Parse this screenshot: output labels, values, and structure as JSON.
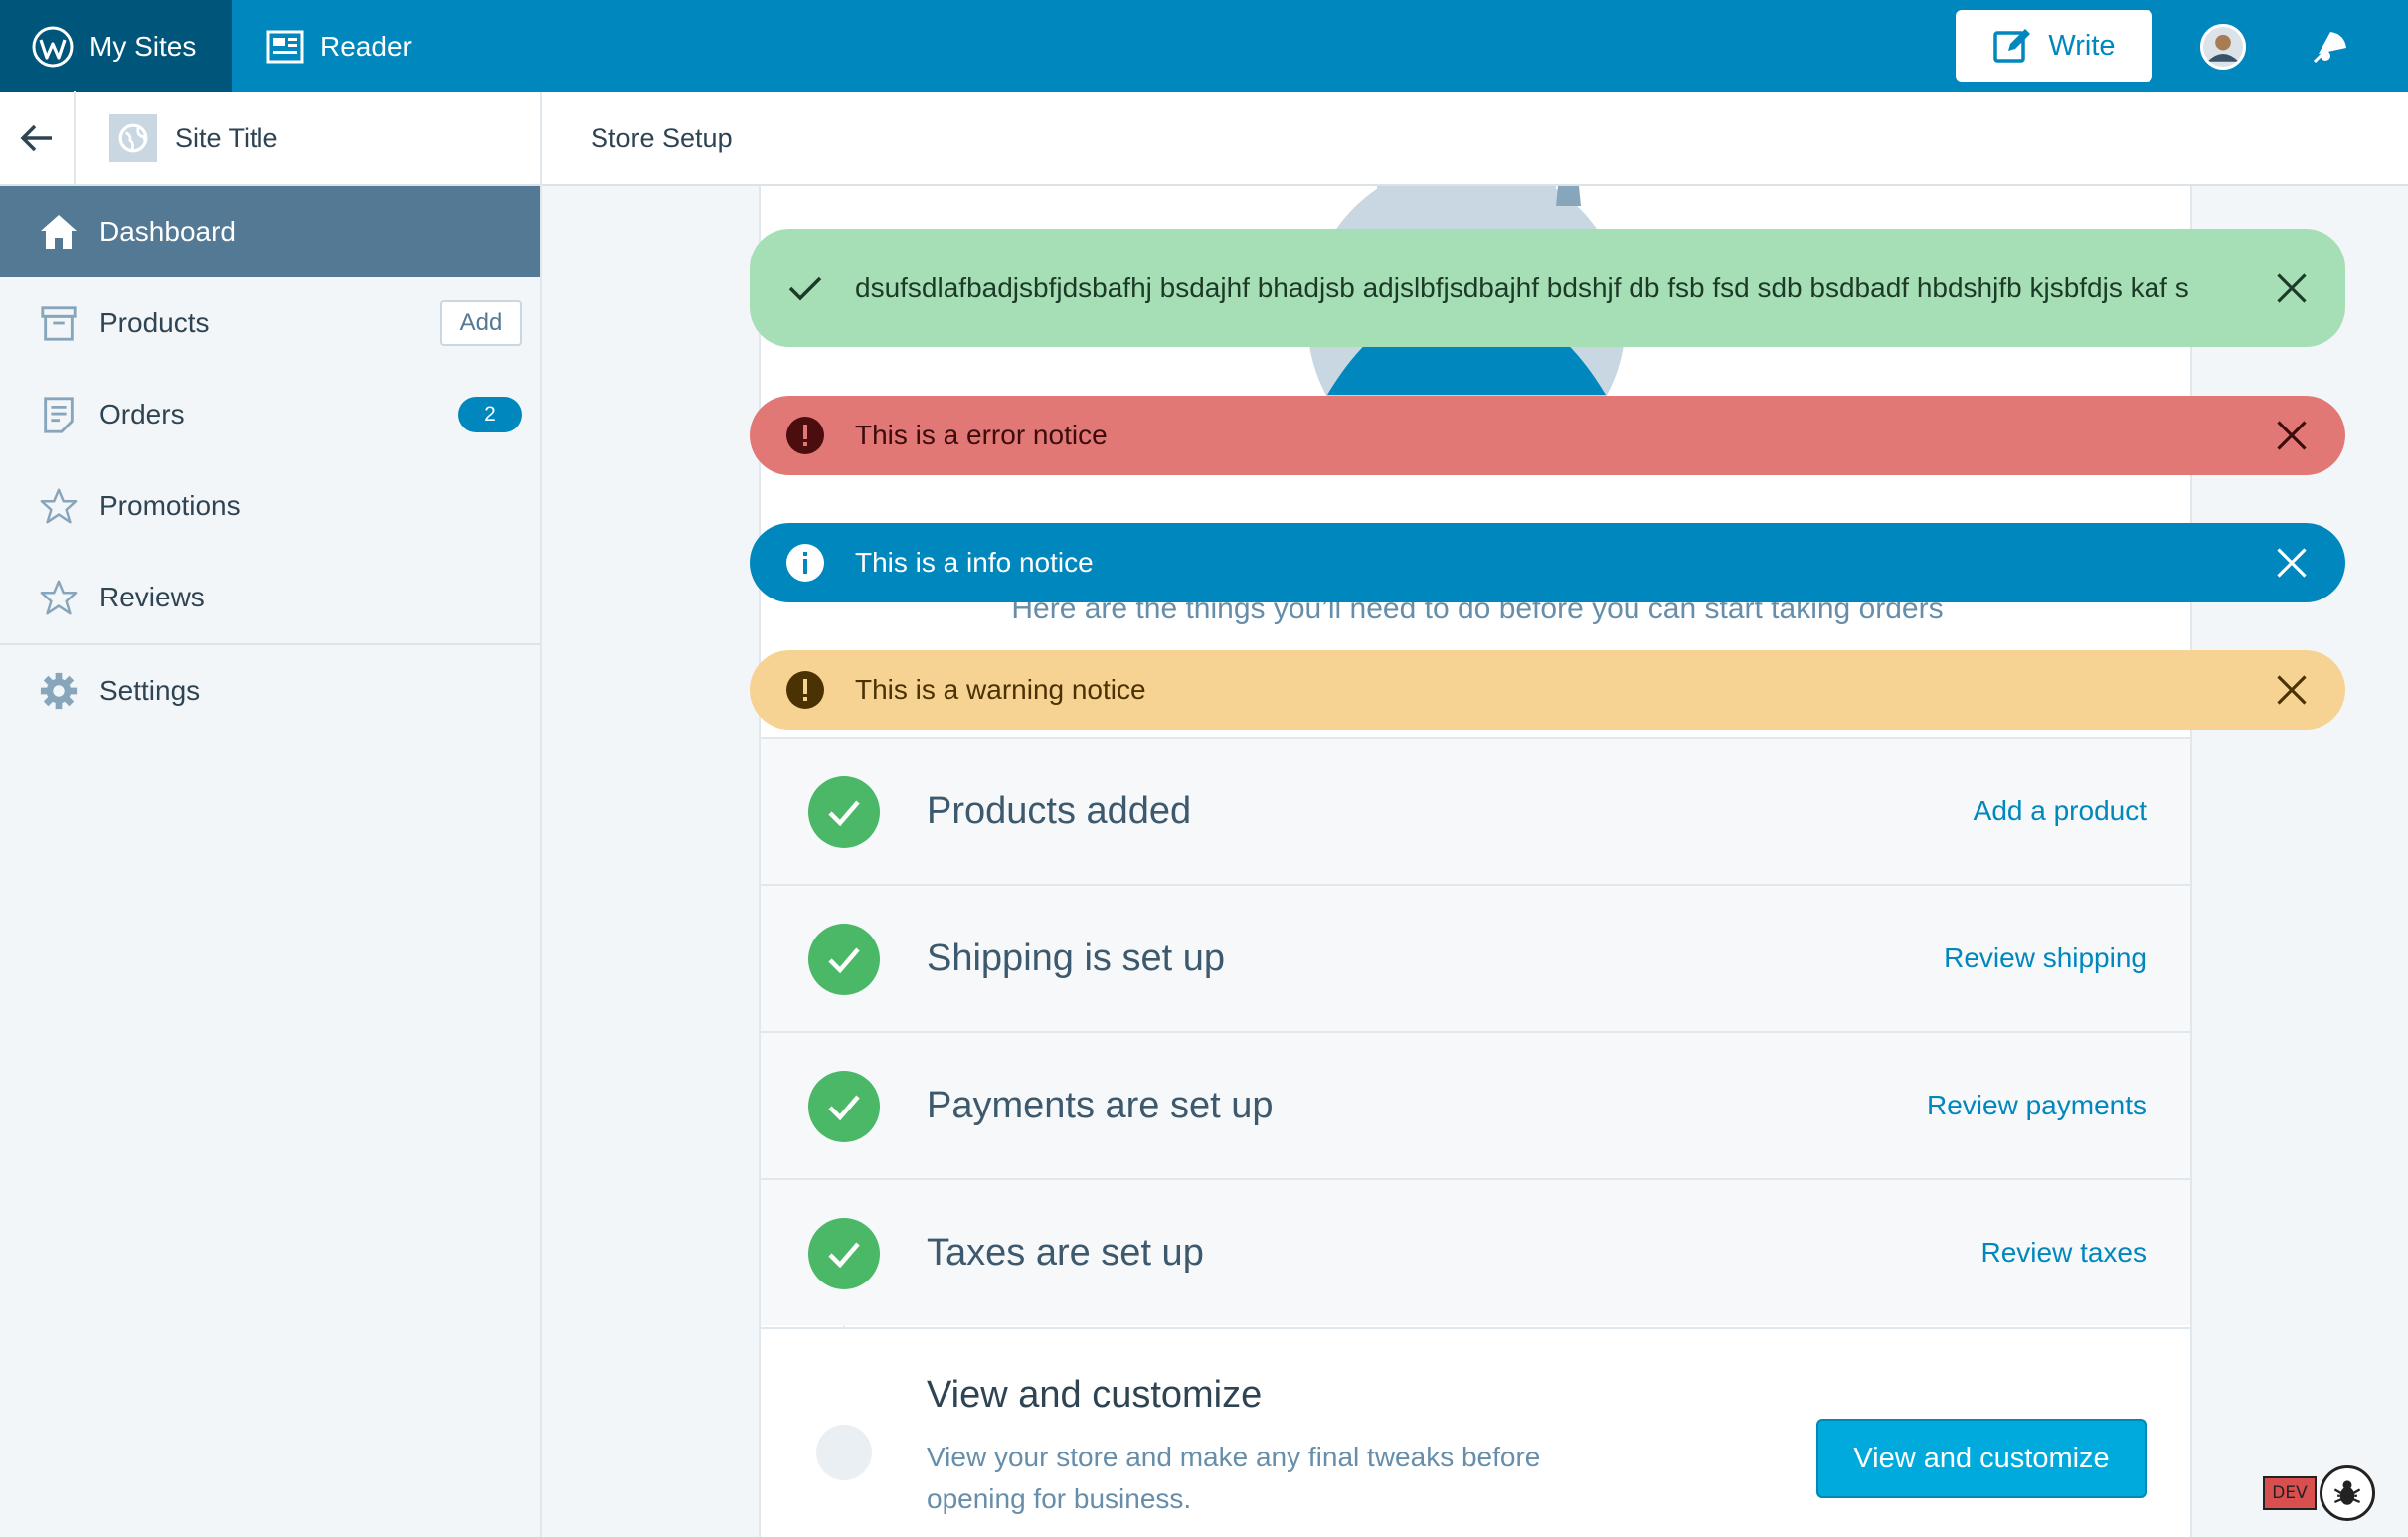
{
  "masterbar": {
    "my_sites": "My Sites",
    "reader": "Reader",
    "write": "Write"
  },
  "sidebar": {
    "site_title": "Site Title",
    "items": [
      {
        "label": "Dashboard",
        "icon": "home-icon",
        "active": true
      },
      {
        "label": "Products",
        "icon": "archive-icon",
        "action": "Add"
      },
      {
        "label": "Orders",
        "icon": "document-icon",
        "count": "2"
      },
      {
        "label": "Promotions",
        "icon": "star-icon"
      },
      {
        "label": "Reviews",
        "icon": "star-icon"
      },
      {
        "label": "Settings",
        "icon": "gear-icon"
      }
    ]
  },
  "header": {
    "title": "Store Setup"
  },
  "intro": {
    "text": "Here are the things you’ll need to do before you can start taking orders"
  },
  "steps": [
    {
      "title": "Products added",
      "link": "Add a product"
    },
    {
      "title": "Shipping is set up",
      "link": "Review shipping"
    },
    {
      "title": "Payments are set up",
      "link": "Review payments"
    },
    {
      "title": "Taxes are set up",
      "link": "Review taxes"
    }
  ],
  "final_step": {
    "title": "View and customize",
    "description": "View your store and make any final tweaks before opening for business.",
    "button": "View and customize"
  },
  "notices": [
    {
      "type": "success",
      "text": "dsufsdlafbadjsbfjdsbafhj bsdajhf bhadjsb adjslbfjsdbajhf bdshjf db fsb fsd sdb bsdbadf hbdshjfb kjsbfdjs kaf s"
    },
    {
      "type": "error",
      "text": "This is a error notice"
    },
    {
      "type": "info",
      "text": "This is a info notice"
    },
    {
      "type": "warning",
      "text": "This is a warning notice"
    }
  ],
  "dev_badge": "DEV",
  "colors": {
    "masterbar": "#0087be",
    "masterbar_active": "#00557a",
    "sidebar_active": "#537994",
    "success": "#a6dfb6",
    "error": "#e27876",
    "info": "#0087be",
    "warning": "#f6d392",
    "check_green": "#4ab866",
    "link": "#0087be",
    "primary_button": "#00aadc"
  }
}
